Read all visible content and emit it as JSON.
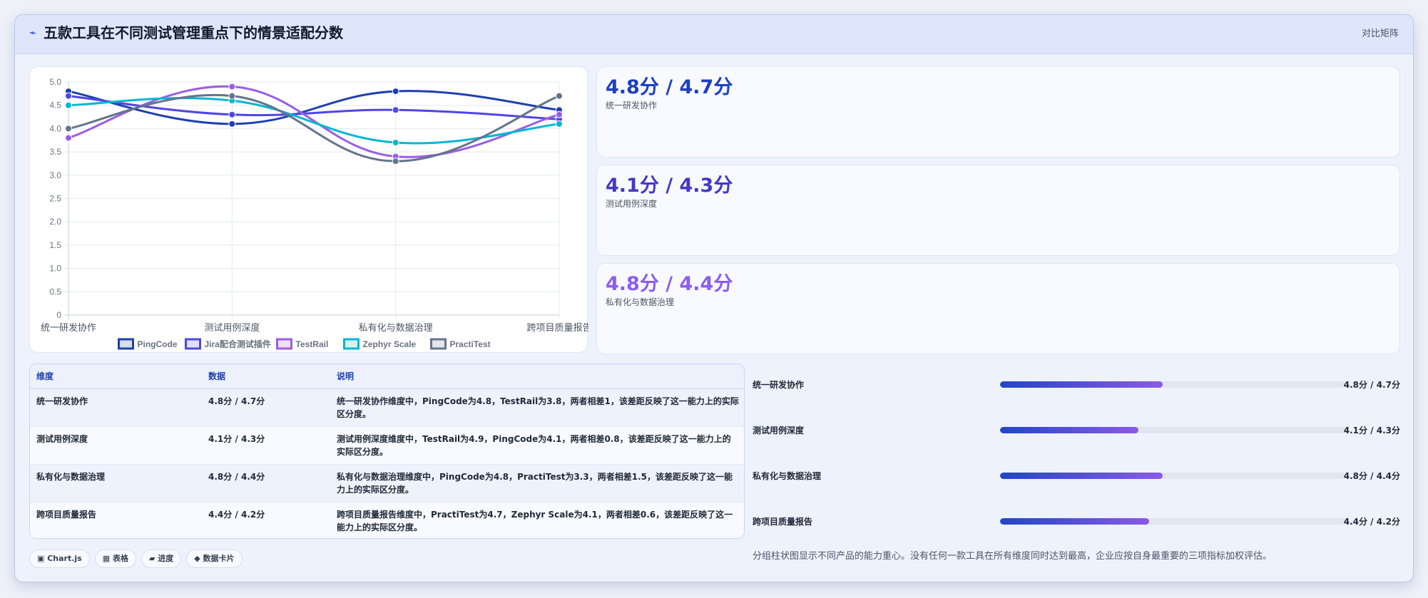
{
  "header": {
    "icon": "pulse-icon",
    "title": "五款工具在不同测试管理重点下的情景适配分数",
    "tag": "对比矩阵"
  },
  "chart_data": {
    "type": "line",
    "categories": [
      "统一研发协作",
      "测试用例深度",
      "私有化与数据治理",
      "跨项目质量报告"
    ],
    "ylim": [
      0,
      5.0
    ],
    "yticks": [
      "0",
      "0.5",
      "1.0",
      "1.5",
      "2.0",
      "2.5",
      "3.0",
      "3.5",
      "4.0",
      "4.5",
      "5.0"
    ],
    "grid": true,
    "legend_position": "bottom",
    "series": [
      {
        "name": "PingCode",
        "color": "#1e40af",
        "values": [
          4.8,
          4.1,
          4.8,
          4.4
        ]
      },
      {
        "name": "Jira配合测试插件",
        "color": "#4f46e5",
        "values": [
          4.7,
          4.3,
          4.4,
          4.2
        ]
      },
      {
        "name": "TestRail",
        "color": "#9b5de5",
        "values": [
          3.8,
          4.9,
          3.4,
          4.3
        ]
      },
      {
        "name": "Zephyr Scale",
        "color": "#06b6d4",
        "values": [
          4.5,
          4.6,
          3.7,
          4.1
        ]
      },
      {
        "name": "PractiTest",
        "color": "#64748b",
        "values": [
          4.0,
          4.7,
          3.3,
          4.7
        ]
      }
    ]
  },
  "stats": [
    {
      "value": "4.8分 / 4.7分",
      "label": "统一研发协作",
      "color": "#1d3fbf"
    },
    {
      "value": "4.1分 / 4.3分",
      "label": "测试用例深度",
      "color": "#4338ca"
    },
    {
      "value": "4.8分 / 4.4分",
      "label": "私有化与数据治理",
      "color": "#8b5cf6"
    }
  ],
  "table": {
    "headers": [
      "维度",
      "数据",
      "说明"
    ],
    "rows": [
      {
        "dim": "统一研发协作",
        "data": "4.8分 / 4.7分",
        "desc": "统一研发协作维度中，PingCode为4.8，TestRail为3.8，两者相差1，该差距反映了这一能力上的实际区分度。"
      },
      {
        "dim": "测试用例深度",
        "data": "4.1分 / 4.3分",
        "desc": "测试用例深度维度中，TestRail为4.9，PingCode为4.1，两者相差0.8，该差距反映了这一能力上的实际区分度。"
      },
      {
        "dim": "私有化与数据治理",
        "data": "4.8分 / 4.4分",
        "desc": "私有化与数据治理维度中，PingCode为4.8，PractiTest为3.3，两者相差1.5，该差距反映了这一能力上的实际区分度。"
      },
      {
        "dim": "跨项目质量报告",
        "data": "4.4分 / 4.2分",
        "desc": "跨项目质量报告维度中，PractiTest为4.7，Zephyr Scale为4.1，两者相差0.6，该差距反映了这一能力上的实际区分度。"
      }
    ]
  },
  "chips": [
    "▣ Chart.js",
    "▦ 表格",
    "▰ 进度",
    "◆ 数据卡片"
  ],
  "bars": [
    {
      "label": "统一研发协作",
      "value": "4.8分 / 4.7分",
      "fraction": 0.47
    },
    {
      "label": "测试用例深度",
      "value": "4.1分 / 4.3分",
      "fraction": 0.4
    },
    {
      "label": "私有化与数据治理",
      "value": "4.8分 / 4.4分",
      "fraction": 0.47
    },
    {
      "label": "跨项目质量报告",
      "value": "4.4分 / 4.2分",
      "fraction": 0.43
    }
  ],
  "summary": "分组柱状图显示不同产品的能力重心。没有任何一款工具在所有维度同时达到最高，企业应按自身最重要的三项指标加权评估。"
}
